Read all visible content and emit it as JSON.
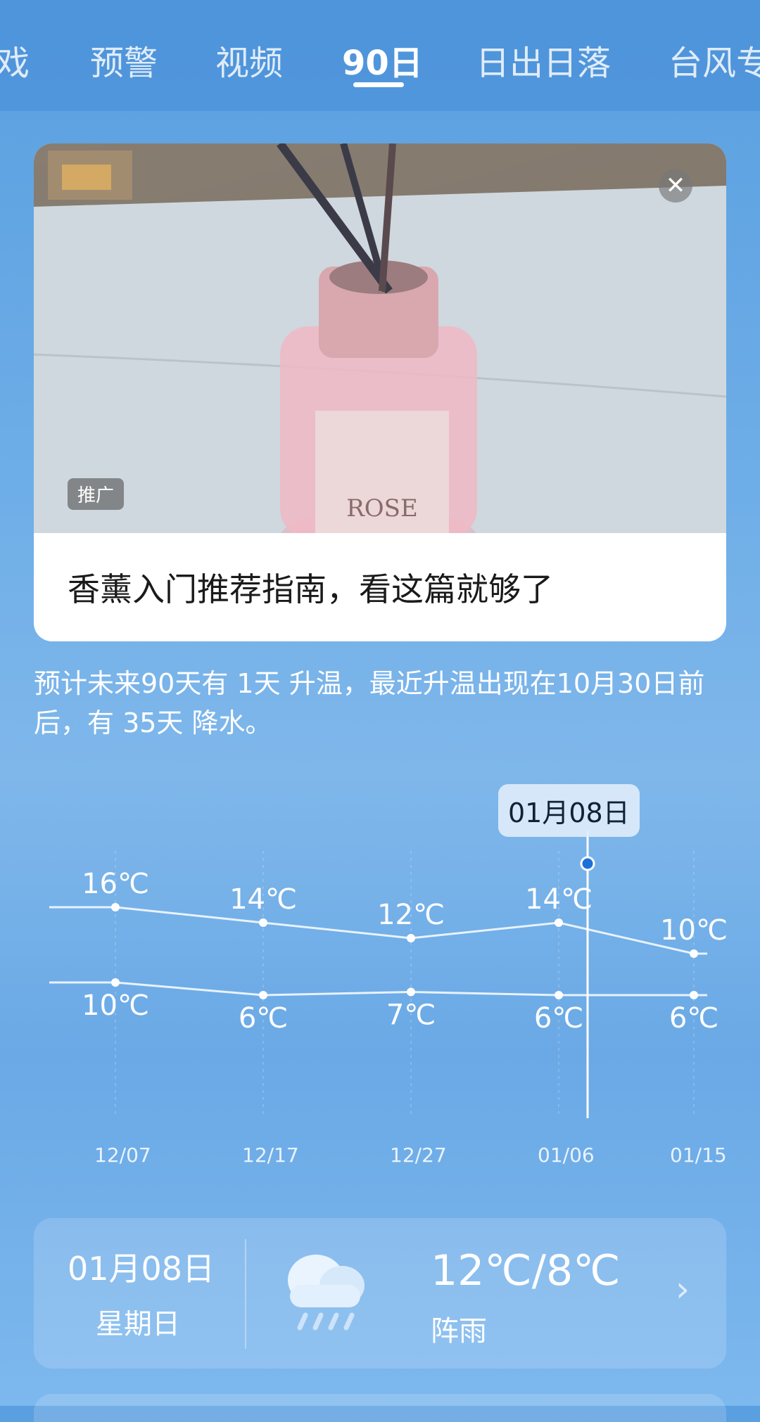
{
  "tabs": [
    {
      "label": "戏"
    },
    {
      "label": "预警"
    },
    {
      "label": "视频"
    },
    {
      "label": "90日",
      "active": true
    },
    {
      "label": "日出日落"
    },
    {
      "label": "台风专"
    }
  ],
  "ad": {
    "tag": "推广",
    "title": "香薰入门推荐指南，看这篇就够了",
    "product_label": "ROSE",
    "close_icon": "close-icon"
  },
  "summary": "预计未来90天有 1天 升温，最近升温出现在10月30日前后，有 35天 降水。",
  "chart_data": {
    "type": "line",
    "x": [
      "12/07",
      "12/17",
      "12/27",
      "01/06",
      "01/15"
    ],
    "series": [
      {
        "values": [
          16,
          14,
          12,
          14,
          10
        ]
      },
      {
        "values": [
          10,
          6,
          7,
          6,
          6
        ]
      }
    ],
    "value_labels_high": [
      "16℃",
      "14℃",
      "12℃",
      "14℃",
      "10℃"
    ],
    "value_labels_low": [
      "10℃",
      "6℃",
      "7℃",
      "6℃",
      "6℃"
    ],
    "selected_label": "01月08日",
    "grid": true,
    "colors": {
      "line": "#e8f2fc",
      "point": "#ffffff",
      "cursor": "#ffffff",
      "cursor_dot": "#1e6fd8"
    }
  },
  "day_detail": {
    "date": "01月08日",
    "weekday": "星期日",
    "temp": "12℃/8℃",
    "condition": "阵雨",
    "icon": "rain-cloud-icon"
  }
}
